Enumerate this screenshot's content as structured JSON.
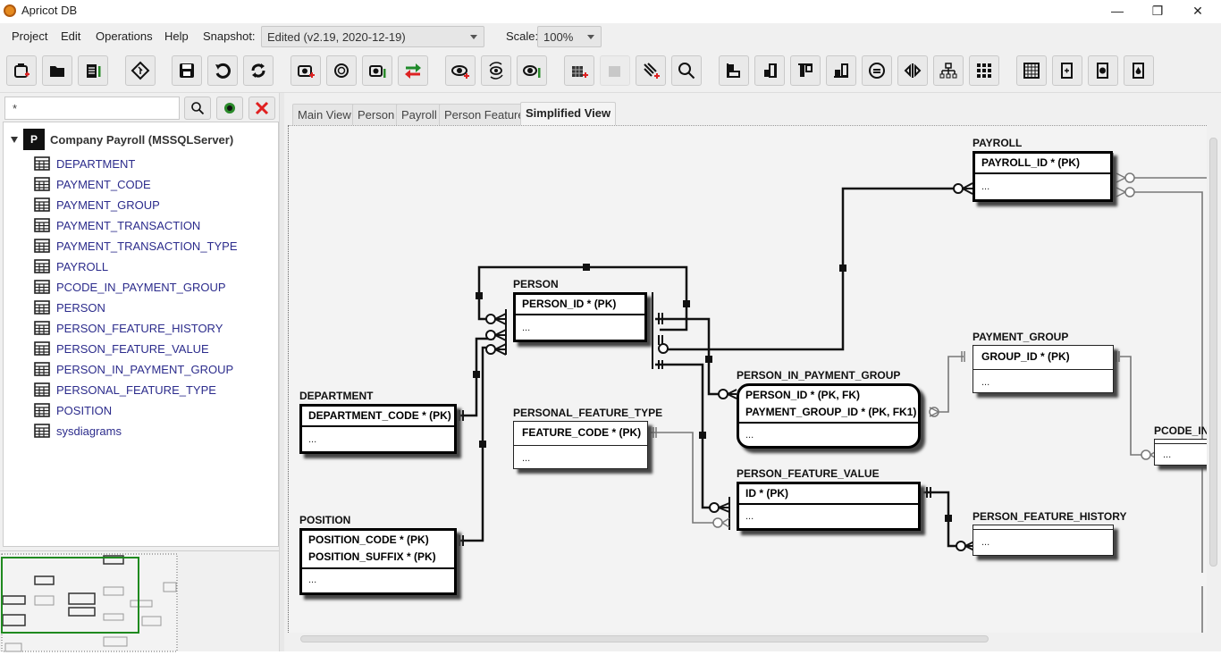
{
  "window": {
    "title": "Apricot DB",
    "minimize_glyph": "—",
    "maximize_glyph": "❐",
    "close_glyph": "✕"
  },
  "menu": {
    "items": [
      "Project",
      "Edit",
      "Operations",
      "Help"
    ],
    "snapshot_label": "Snapshot:",
    "snapshot_value": "Edited (v2.19, 2020-12-19)",
    "scale_label": "Scale:",
    "scale_value": "100%"
  },
  "toolbar": {
    "buttons": [
      {
        "name": "new-project",
        "icon": "new-project-icon"
      },
      {
        "name": "open-project",
        "icon": "folder-icon"
      },
      {
        "name": "project-properties",
        "icon": "clipboard-edit-icon"
      },
      {
        "name": "git",
        "icon": "git-icon"
      },
      {
        "name": "save",
        "icon": "floppy-icon"
      },
      {
        "name": "undo",
        "icon": "undo-icon"
      },
      {
        "name": "refresh",
        "icon": "refresh-icon"
      },
      {
        "name": "new-snapshot",
        "icon": "camera-add-icon"
      },
      {
        "name": "restore-snapshot",
        "icon": "history-icon"
      },
      {
        "name": "edit-snapshot",
        "icon": "camera-edit-icon"
      },
      {
        "name": "compare",
        "icon": "swap-arrows-icon"
      },
      {
        "name": "new-view",
        "icon": "eye-add-icon"
      },
      {
        "name": "refresh-view",
        "icon": "eye-refresh-icon"
      },
      {
        "name": "edit-view",
        "icon": "eye-edit-icon"
      },
      {
        "name": "add-table",
        "icon": "table-add-icon"
      },
      {
        "name": "remove-table",
        "icon": "table-remove-icon",
        "disabled": true
      },
      {
        "name": "add-relationship",
        "icon": "relationship-add-icon"
      },
      {
        "name": "find",
        "icon": "search-icon"
      },
      {
        "name": "align-left",
        "icon": "align-left-icon"
      },
      {
        "name": "align-right",
        "icon": "align-right-icon"
      },
      {
        "name": "align-top",
        "icon": "align-top-icon"
      },
      {
        "name": "align-bottom",
        "icon": "align-bottom-icon"
      },
      {
        "name": "resize",
        "icon": "resize-icon"
      },
      {
        "name": "distribute",
        "icon": "distribute-icon"
      },
      {
        "name": "hierarchy-layout",
        "icon": "hierarchy-icon"
      },
      {
        "name": "grid-layout",
        "icon": "grid-icon"
      },
      {
        "name": "data-view",
        "icon": "spreadsheet-icon"
      },
      {
        "name": "new-script",
        "icon": "script-add-icon"
      },
      {
        "name": "run-script",
        "icon": "script-run-icon"
      },
      {
        "name": "script-options",
        "icon": "script-drop-icon"
      }
    ]
  },
  "sidebar": {
    "search_value": "*",
    "project": {
      "label": "Company Payroll (MSSQLServer)",
      "icon_text": "P"
    },
    "tables": [
      "DEPARTMENT",
      "PAYMENT_CODE",
      "PAYMENT_GROUP",
      "PAYMENT_TRANSACTION",
      "PAYMENT_TRANSACTION_TYPE",
      "PAYROLL",
      "PCODE_IN_PAYMENT_GROUP",
      "PERSON",
      "PERSON_FEATURE_HISTORY",
      "PERSON_FEATURE_VALUE",
      "PERSON_IN_PAYMENT_GROUP",
      "PERSONAL_FEATURE_TYPE",
      "POSITION",
      "sysdiagrams"
    ]
  },
  "tabs": [
    {
      "label": "Main View",
      "active": false
    },
    {
      "label": "Person",
      "active": false
    },
    {
      "label": "Payroll",
      "active": false
    },
    {
      "label": "Person Feature",
      "active": false
    },
    {
      "label": "Simplified View",
      "active": true
    }
  ],
  "diagram": {
    "entities": [
      {
        "id": "payroll",
        "name": "PAYROLL",
        "columns": [
          "PAYROLL_ID * (PK)"
        ],
        "more": "...",
        "style": "bold"
      },
      {
        "id": "person",
        "name": "PERSON",
        "columns": [
          "PERSON_ID * (PK)"
        ],
        "more": "...",
        "style": "bold"
      },
      {
        "id": "department",
        "name": "DEPARTMENT",
        "columns": [
          "DEPARTMENT_CODE * (PK)"
        ],
        "more": "...",
        "style": "bold"
      },
      {
        "id": "position",
        "name": "POSITION",
        "columns": [
          "POSITION_CODE * (PK)",
          "POSITION_SUFFIX * (PK)"
        ],
        "more": "...",
        "style": "bold"
      },
      {
        "id": "personal_feature_type",
        "name": "PERSONAL_FEATURE_TYPE",
        "columns": [
          "FEATURE_CODE * (PK)"
        ],
        "more": "...",
        "style": "thin"
      },
      {
        "id": "person_in_payment_group",
        "name": "PERSON_IN_PAYMENT_GROUP",
        "columns": [
          "PERSON_ID * (PK, FK)",
          "PAYMENT_GROUP_ID * (PK, FK1)"
        ],
        "more": "...",
        "style": "rounded"
      },
      {
        "id": "payment_group",
        "name": "PAYMENT_GROUP",
        "columns": [
          "GROUP_ID * (PK)"
        ],
        "more": "...",
        "style": "thin"
      },
      {
        "id": "person_feature_value",
        "name": "PERSON_FEATURE_VALUE",
        "columns": [
          "ID * (PK)"
        ],
        "more": "...",
        "style": "bold"
      },
      {
        "id": "person_feature_history",
        "name": "PERSON_FEATURE_HISTORY",
        "columns": [],
        "more": "...",
        "style": "thin"
      },
      {
        "id": "pcode_in_payment_group",
        "name": "PCODE_IN",
        "columns": [],
        "more": "...",
        "style": "thin"
      }
    ]
  }
}
